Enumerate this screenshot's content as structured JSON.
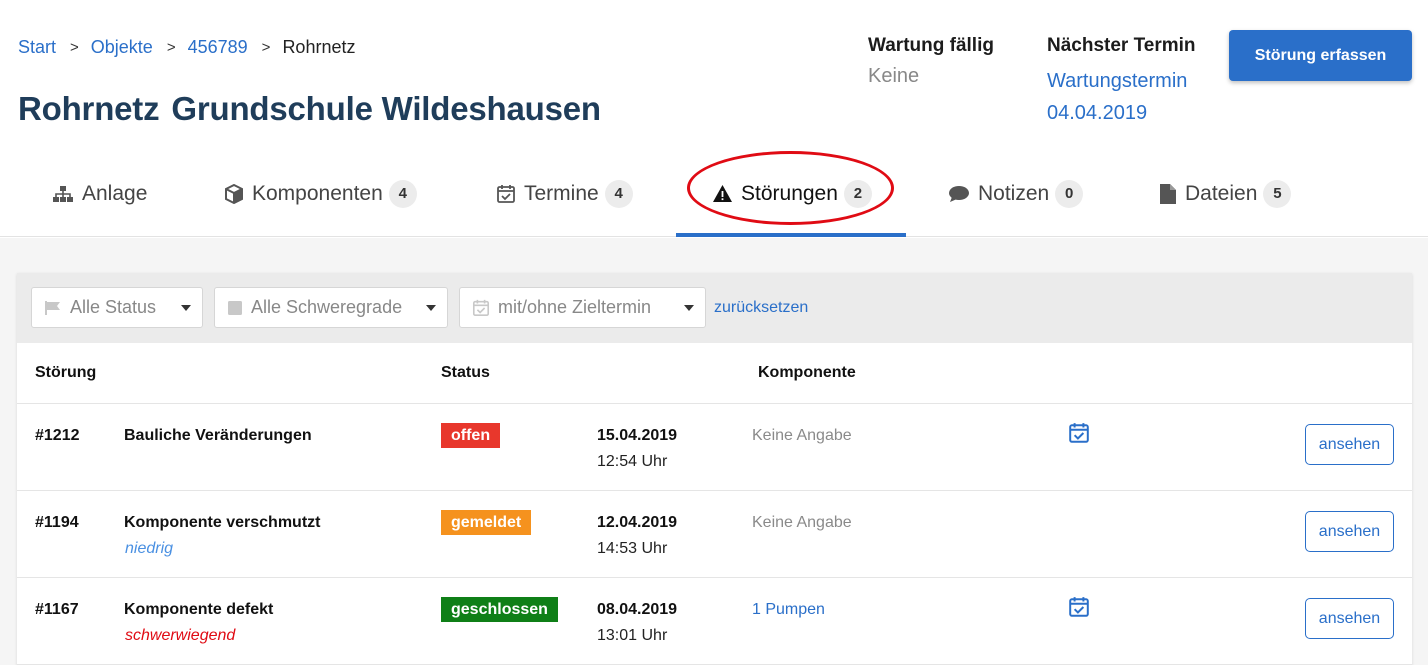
{
  "breadcrumb": {
    "items": [
      "Start",
      "Objekte",
      "456789"
    ],
    "current": "Rohrnetz",
    "separator": ">"
  },
  "title": {
    "main": "Rohrnetz",
    "sub": "Grundschule Wildeshausen"
  },
  "maintenance_due": {
    "label": "Wartung fällig",
    "value": "Keine"
  },
  "next_appointment": {
    "label": "Nächster Termin",
    "link_line1": "Wartungstermin",
    "link_line2": "04.04.2019"
  },
  "primary_action": {
    "label": "Störung erfassen"
  },
  "tabs": [
    {
      "label": "Anlage",
      "count": "",
      "icon": "sitemap-icon"
    },
    {
      "label": "Komponenten",
      "count": "4",
      "icon": "cube-icon"
    },
    {
      "label": "Termine",
      "count": "4",
      "icon": "calendar-check-icon"
    },
    {
      "label": "Störungen",
      "count": "2",
      "icon": "warning-icon",
      "active": true
    },
    {
      "label": "Notizen",
      "count": "0",
      "icon": "comment-icon"
    },
    {
      "label": "Dateien",
      "count": "5",
      "icon": "file-icon"
    }
  ],
  "filters": {
    "status": "Alle Status",
    "severity": "Alle Schweregrade",
    "deadline": "mit/ohne Zieltermin",
    "reset": "zurücksetzen"
  },
  "table": {
    "headers": {
      "issue": "Störung",
      "status": "Status",
      "component": "Komponente"
    },
    "rows": [
      {
        "id": "#1212",
        "name": "Bauliche Veränderungen",
        "severity": "",
        "severity_color": "",
        "status": "offen",
        "status_color": "#e8372c",
        "date": "15.04.2019",
        "time": "12:54 Uhr",
        "component": "Keine Angabe",
        "component_is_link": false,
        "has_deadline": true,
        "action": "ansehen"
      },
      {
        "id": "#1194",
        "name": "Komponente verschmutzt",
        "severity": "niedrig",
        "severity_color": "#4a90e2",
        "status": "gemeldet",
        "status_color": "#f5921e",
        "date": "12.04.2019",
        "time": "14:53 Uhr",
        "component": "Keine Angabe",
        "component_is_link": false,
        "has_deadline": false,
        "action": "ansehen"
      },
      {
        "id": "#1167",
        "name": "Komponente defekt",
        "severity": "schwerwiegend",
        "severity_color": "#e00b14",
        "status": "geschlossen",
        "status_color": "#0f7f17",
        "date": "08.04.2019",
        "time": "13:01 Uhr",
        "component": "1 Pumpen",
        "component_is_link": true,
        "has_deadline": true,
        "action": "ansehen"
      }
    ]
  },
  "colors": {
    "accent": "#2a6fc9",
    "highlight": "#e00b14"
  }
}
